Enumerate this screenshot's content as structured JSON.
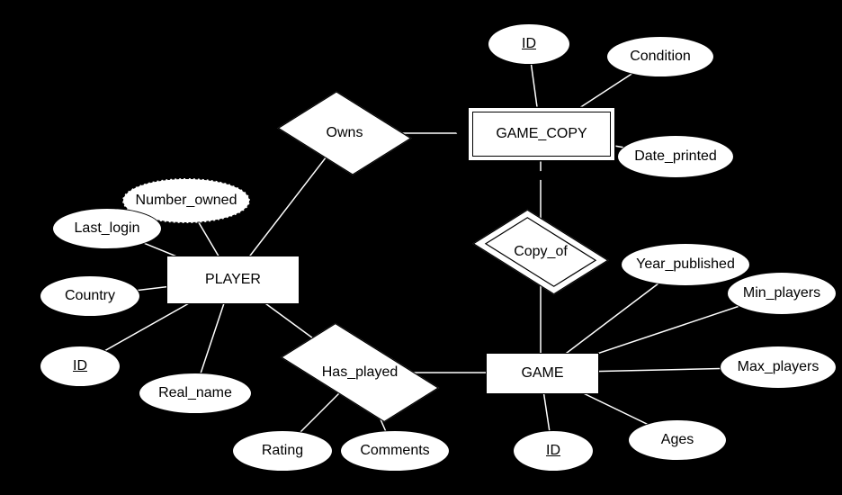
{
  "entities": {
    "player": "PLAYER",
    "game_copy": "GAME_COPY",
    "game": "GAME"
  },
  "relationships": {
    "owns": "Owns",
    "copy_of": "Copy_of",
    "has_played": "Has_played"
  },
  "attributes": {
    "player": {
      "number_owned": "Number_owned",
      "last_login": "Last_login",
      "country": "Country",
      "id": "ID",
      "real_name": "Real_name"
    },
    "game_copy": {
      "id": "ID",
      "condition": "Condition",
      "date_printed": "Date_printed"
    },
    "game": {
      "year_published": "Year_published",
      "min_players": "Min_players",
      "max_players": "Max_players",
      "ages": "Ages",
      "id": "ID"
    },
    "has_played": {
      "rating": "Rating",
      "comments": "Comments"
    }
  },
  "chart_data": {
    "type": "er_diagram",
    "entities": [
      {
        "name": "PLAYER",
        "weak": false,
        "key": "ID",
        "attributes": [
          "Number_owned (derived)",
          "Last_login",
          "Country",
          "ID",
          "Real_name"
        ]
      },
      {
        "name": "GAME_COPY",
        "weak": true,
        "partial_key": "ID",
        "attributes": [
          "ID",
          "Condition",
          "Date_printed"
        ]
      },
      {
        "name": "GAME",
        "weak": false,
        "key": "ID",
        "attributes": [
          "Year_published",
          "Min_players",
          "Max_players",
          "Ages",
          "ID"
        ]
      }
    ],
    "relationships": [
      {
        "name": "Owns",
        "between": [
          "PLAYER",
          "GAME_COPY"
        ],
        "identifying": false
      },
      {
        "name": "Copy_of",
        "between": [
          "GAME_COPY",
          "GAME"
        ],
        "identifying": true
      },
      {
        "name": "Has_played",
        "between": [
          "PLAYER",
          "GAME"
        ],
        "identifying": false,
        "attributes": [
          "Rating",
          "Comments"
        ]
      }
    ]
  }
}
